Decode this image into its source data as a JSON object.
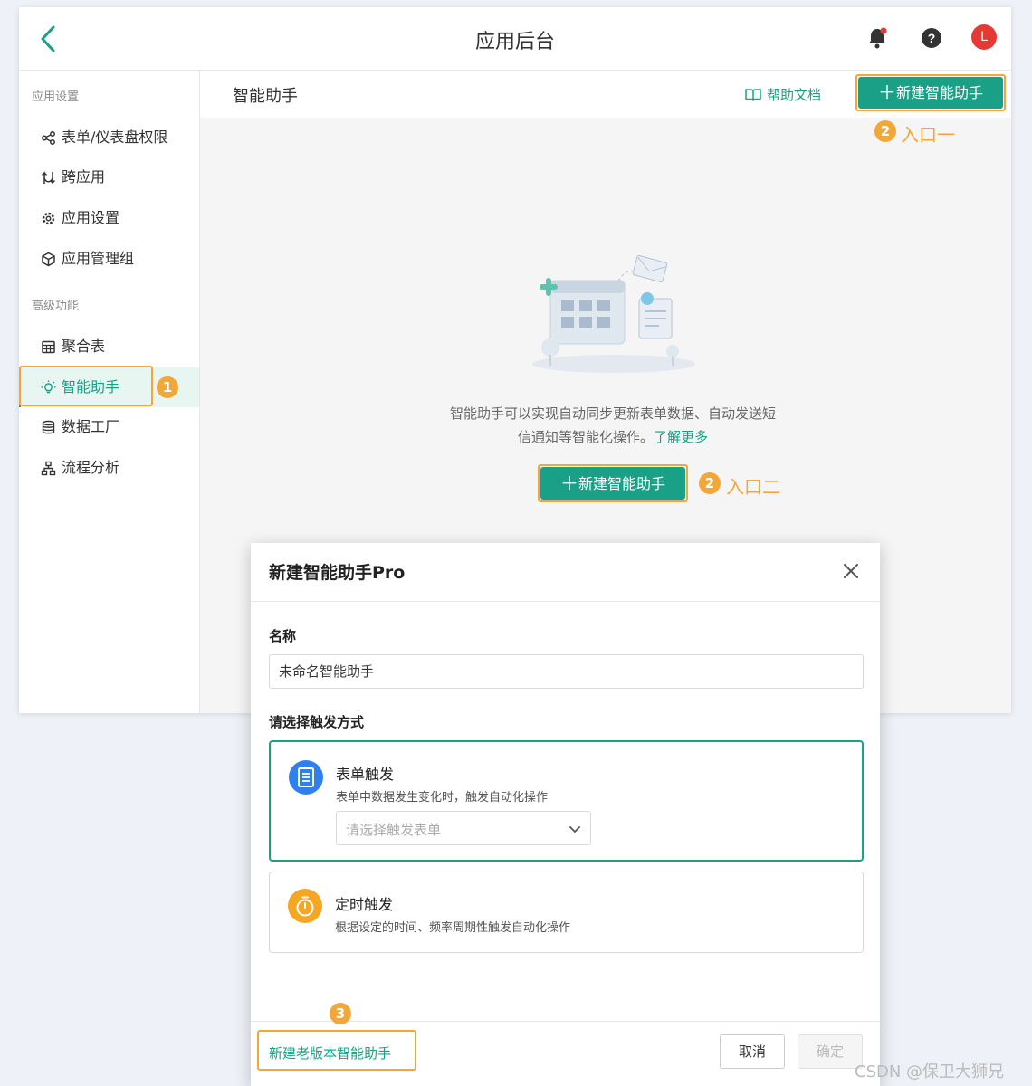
{
  "header": {
    "title": "应用后台",
    "avatar_letter": "L"
  },
  "sidebar": {
    "groups": [
      {
        "label": "应用设置"
      },
      {
        "label": "高级功能"
      }
    ],
    "items": [
      {
        "label": "表单/仪表盘权限",
        "icon": "share-icon"
      },
      {
        "label": "跨应用",
        "icon": "cross-app-icon"
      },
      {
        "label": "应用设置",
        "icon": "gear-icon"
      },
      {
        "label": "应用管理组",
        "icon": "cube-icon"
      },
      {
        "label": "聚合表",
        "icon": "table-icon"
      },
      {
        "label": "智能助手",
        "icon": "bulb-icon",
        "active": true
      },
      {
        "label": "数据工厂",
        "icon": "database-icon"
      },
      {
        "label": "流程分析",
        "icon": "flow-icon"
      }
    ]
  },
  "content": {
    "page_title": "智能助手",
    "help_link": "帮助文档",
    "new_button": "新建智能助手",
    "empty_line1": "智能助手可以实现自动同步更新表单数据、自动发送短",
    "empty_line2": "信通知等智能化操作。",
    "learn_more": "了解更多",
    "center_button": "新建智能助手"
  },
  "annotations": {
    "badge1": "1",
    "badge2": "2",
    "badge3": "3",
    "entry1": "入口一",
    "entry2": "入口二"
  },
  "modal": {
    "title": "新建智能助手Pro",
    "name_label": "名称",
    "name_value": "未命名智能助手",
    "trigger_label": "请选择触发方式",
    "triggers": [
      {
        "title": "表单触发",
        "desc": "表单中数据发生变化时，触发自动化操作",
        "select_placeholder": "请选择触发表单",
        "icon": "form-icon",
        "selected": true
      },
      {
        "title": "定时触发",
        "desc": "根据设定的时间、频率周期性触发自动化操作",
        "icon": "timer-icon",
        "selected": false
      }
    ],
    "legacy_link": "新建老版本智能助手",
    "cancel": "取消",
    "ok": "确定"
  },
  "watermark": "CSDN @保卫大狮兄",
  "colors": {
    "accent": "#19a086",
    "highlight": "#f2a73b",
    "avatar": "#e53935",
    "form_icon": "#2f80ed",
    "timer_icon": "#f5a623"
  }
}
